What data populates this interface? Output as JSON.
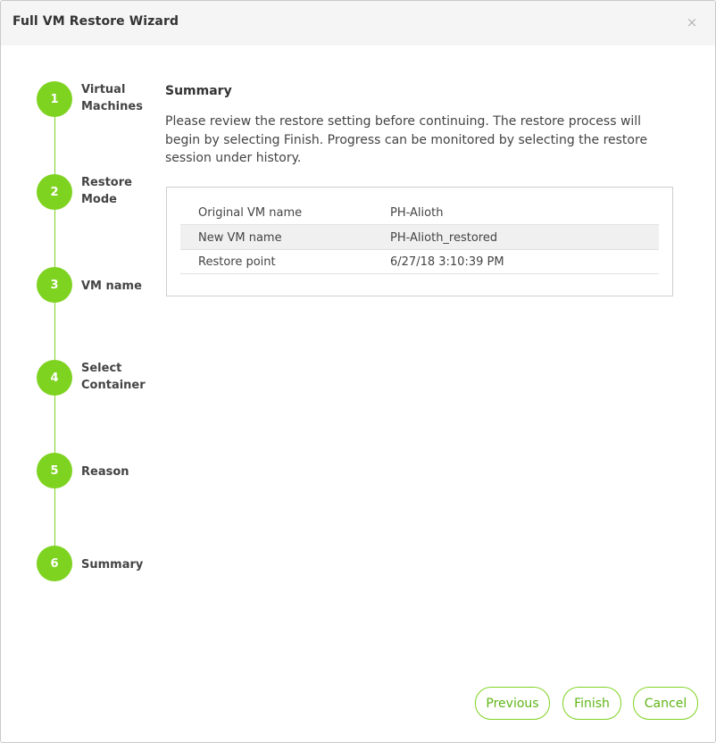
{
  "dialog": {
    "title": "Full VM Restore Wizard",
    "close_icon": "×"
  },
  "steps": [
    {
      "number": "1",
      "label": "Virtual Machines"
    },
    {
      "number": "2",
      "label": "Restore Mode"
    },
    {
      "number": "3",
      "label": "VM name"
    },
    {
      "number": "4",
      "label": "Select Container"
    },
    {
      "number": "5",
      "label": "Reason"
    },
    {
      "number": "6",
      "label": "Summary"
    }
  ],
  "summary": {
    "title": "Summary",
    "description": "Please review the restore setting before continuing. The restore process will begin by selecting Finish. Progress can be monitored by selecting the restore session under history.",
    "rows": [
      {
        "label": "Original VM name",
        "value": "PH-Alioth"
      },
      {
        "label": "New VM name",
        "value": "PH-Alioth_restored"
      },
      {
        "label": "Restore point",
        "value": "6/27/18 3:10:39 PM"
      }
    ]
  },
  "buttons": {
    "previous": "Previous",
    "finish": "Finish",
    "cancel": "Cancel"
  },
  "colors": {
    "accent": "#7ed321",
    "button_text": "#5fb515",
    "titlebar": "#f5f5f5"
  }
}
